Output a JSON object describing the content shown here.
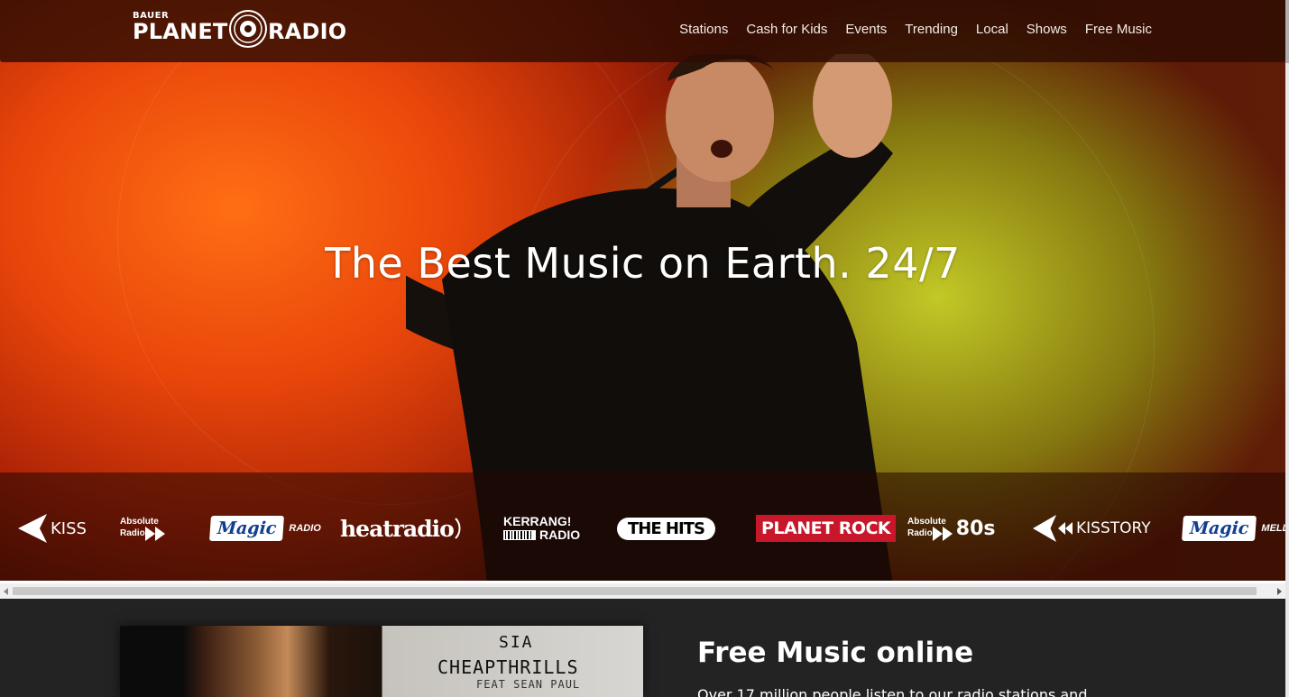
{
  "header": {
    "logo": {
      "bauer": "BAUER",
      "planet": "PLANET",
      "radio": "RADIO"
    },
    "nav": [
      "Stations",
      "Cash for Kids",
      "Events",
      "Trending",
      "Local",
      "Shows",
      "Free Music"
    ]
  },
  "hero": {
    "headline": "The Best Music on Earth. 24/7"
  },
  "stations": {
    "kiss": "KISS",
    "absolute_line1": "Absolute",
    "absolute_line2": "Radio",
    "magic": "Magic",
    "magic_suffix": "RADIO",
    "heat": "heatradio",
    "kerrang_line1": "KERRANG!",
    "kerrang_line2": "RADIO",
    "hits": "THE HITS",
    "planetrock": "PLANET ROCK",
    "abs80_line1": "Absolute",
    "abs80_line2": "Radio",
    "abs80_big": "80s",
    "kisstory": "KISSTORY",
    "magic_mellow": "Magic",
    "mellow_suffix": "MELLOW"
  },
  "lower": {
    "title": "Free Music online",
    "body": "Over 17 million people listen to our radio stations and",
    "album": {
      "artist": "SIA",
      "song": "CHEAPTHRILLS",
      "feat": "FEAT SEAN PAUL"
    }
  },
  "colors": {
    "planet_rock": "#c8172a",
    "magic": "#123e8f",
    "lower_bg": "#232323"
  }
}
